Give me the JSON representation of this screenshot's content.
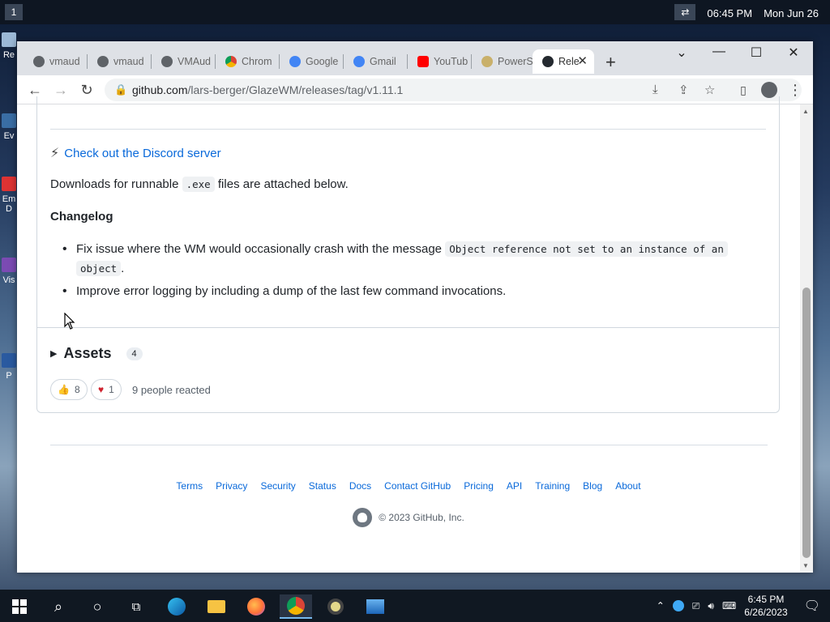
{
  "desktop": {
    "workspace": "1",
    "time": "06:45 PM",
    "date": "Mon Jun 26",
    "toggle_icon": "swap-arrows",
    "icons": [
      "Re",
      "Ev",
      "Em D",
      "Vis",
      "P"
    ]
  },
  "browser": {
    "tabs": [
      {
        "label": "vmaud",
        "icon": "globe-icon"
      },
      {
        "label": "vmaud",
        "icon": "globe-icon"
      },
      {
        "label": "VMAud",
        "icon": "globe-icon"
      },
      {
        "label": "Chrom",
        "icon": "chrome-store-icon"
      },
      {
        "label": "Google",
        "icon": "google-icon"
      },
      {
        "label": "Gmail",
        "icon": "google-icon"
      },
      {
        "label": "YouTub",
        "icon": "youtube-icon"
      },
      {
        "label": "PowerS",
        "icon": "powershell-icon"
      },
      {
        "label": "Rele",
        "icon": "github-icon",
        "active": true
      }
    ],
    "url_host": "github.com",
    "url_path": "/lars-berger/GlazeWM/releases/tag/v1.11.1"
  },
  "release": {
    "discord_link": "Check out the Discord server",
    "downloads_pre": "Downloads for runnable",
    "downloads_code": ".exe",
    "downloads_post": "files are attached below.",
    "changelog_heading": "Changelog",
    "item1_text": "Fix issue where the WM would occasionally crash with the message",
    "item1_code1": "Object reference not set to an instance of an",
    "item1_code2": "object",
    "item1_end": ".",
    "item2_text": "Improve error logging by including a dump of the last few command invocations.",
    "assets_label": "Assets",
    "assets_count": "4",
    "thumbs_count": "8",
    "heart_count": "1",
    "reacted_text": "9 people reacted"
  },
  "footer": {
    "links": [
      "Terms",
      "Privacy",
      "Security",
      "Status",
      "Docs",
      "Contact GitHub",
      "Pricing",
      "API",
      "Training",
      "Blog",
      "About"
    ],
    "copyright": "© 2023 GitHub, Inc."
  },
  "taskbar": {
    "clock_time": "6:45 PM",
    "clock_date": "6/26/2023"
  }
}
